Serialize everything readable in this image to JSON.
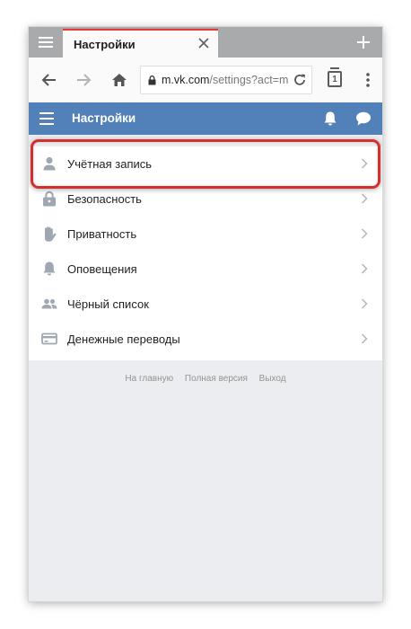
{
  "browser": {
    "tab_title": "Настройки",
    "url_host": "m.vk.com",
    "url_path": "/settings?act=m",
    "open_tabs": "1",
    "accent_color": "#e53935"
  },
  "vk_header": {
    "title": "Настройки",
    "color": "#5181b8"
  },
  "settings_items": [
    {
      "label": "Учётная запись",
      "icon": "person-icon"
    },
    {
      "label": "Безопасность",
      "icon": "lock-icon"
    },
    {
      "label": "Приватность",
      "icon": "hand-icon"
    },
    {
      "label": "Оповещения",
      "icon": "bell-icon"
    },
    {
      "label": "Чёрный список",
      "icon": "people-icon"
    },
    {
      "label": "Денежные переводы",
      "icon": "card-icon"
    }
  ],
  "footer": {
    "home": "На главную",
    "full_version": "Полная версия",
    "logout": "Выход"
  }
}
